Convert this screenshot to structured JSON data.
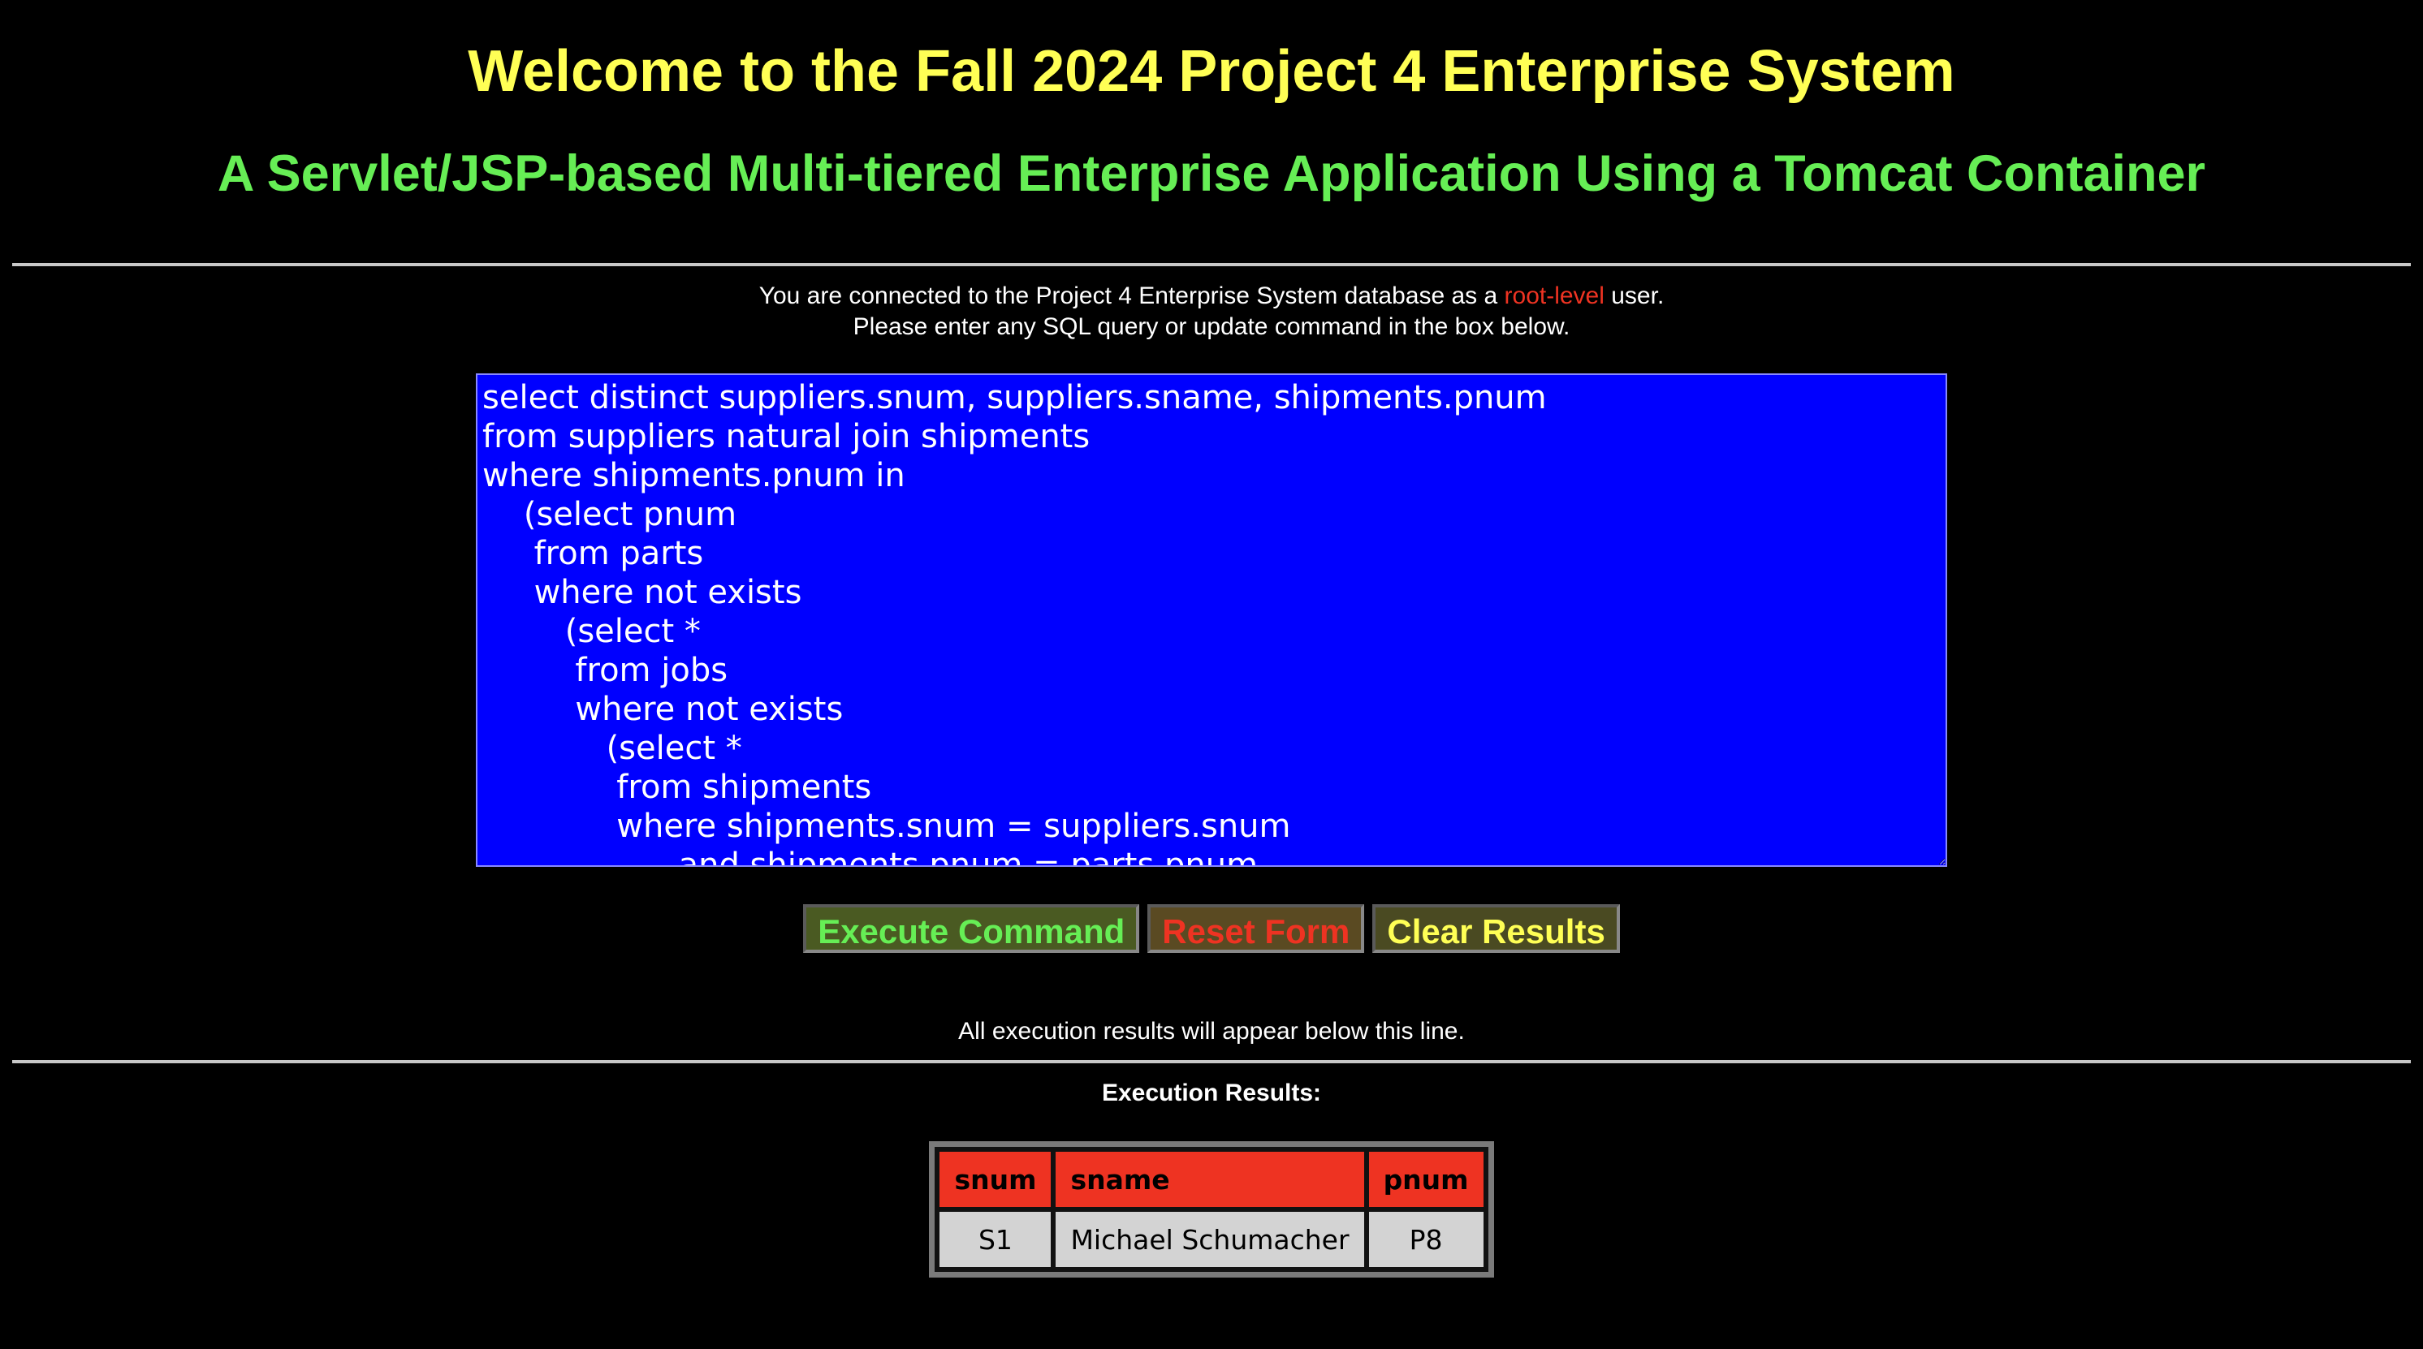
{
  "header": {
    "title": "Welcome to the Fall 2024 Project 4 Enterprise System",
    "subtitle": "A Servlet/JSP-based Multi-tiered Enterprise Application Using a Tomcat Container"
  },
  "connection": {
    "line1_prefix": "You are connected to the Project 4 Enterprise System database as a ",
    "user_level": "root-level",
    "line1_suffix": " user.",
    "line2": "Please enter any SQL query or update command in the box below."
  },
  "editor": {
    "value": "select distinct suppliers.snum, suppliers.sname, shipments.pnum\nfrom suppliers natural join shipments\nwhere shipments.pnum in\n    (select pnum\n     from parts\n     where not exists\n        (select *\n         from jobs\n         where not exists\n            (select *\n             from shipments\n             where shipments.snum = suppliers.snum\n                   and shipments.pnum = parts.pnum"
  },
  "buttons": {
    "execute": "Execute Command",
    "reset": "Reset Form",
    "clear": "Clear Results"
  },
  "results": {
    "note": "All execution results will appear below this line.",
    "label": "Execution Results:",
    "columns": [
      "snum",
      "sname",
      "pnum"
    ],
    "rows": [
      [
        "S1",
        "Michael Schumacher",
        "P8"
      ]
    ]
  },
  "colors": {
    "title": "#ffff55",
    "subtitle": "#66ee55",
    "highlight": "#ee3322",
    "editor_bg": "#0000ff"
  }
}
